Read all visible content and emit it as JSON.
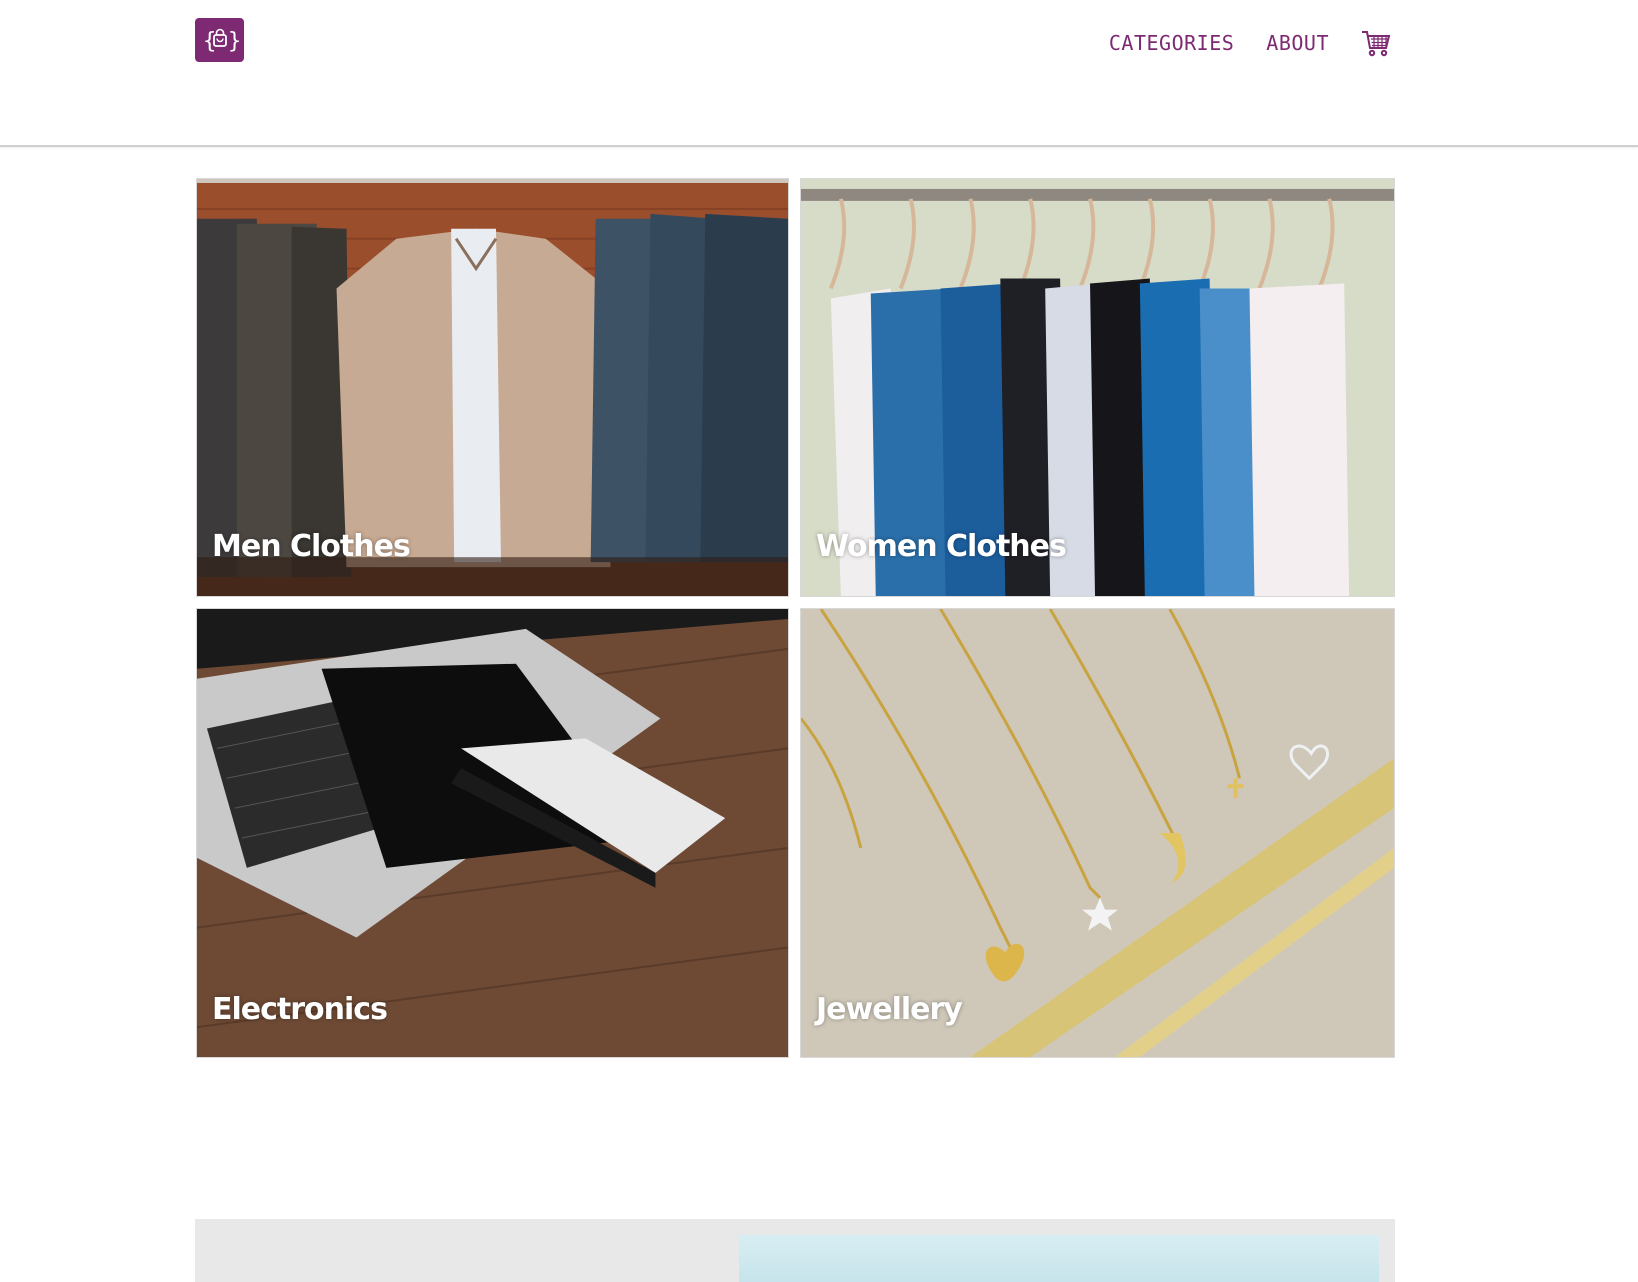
{
  "header": {
    "logo_icon": "shopping-bag-icon",
    "nav": {
      "categories_label": "CATEGORIES",
      "about_label": "ABOUT",
      "cart_icon": "shopping-cart-icon"
    }
  },
  "categories": [
    {
      "label": "Men Clothes"
    },
    {
      "label": "Women Clothes"
    },
    {
      "label": "Electronics"
    },
    {
      "label": "Jewellery"
    }
  ],
  "colors": {
    "brand": "#7d2a72",
    "footer_band": "#e8e8e8"
  }
}
